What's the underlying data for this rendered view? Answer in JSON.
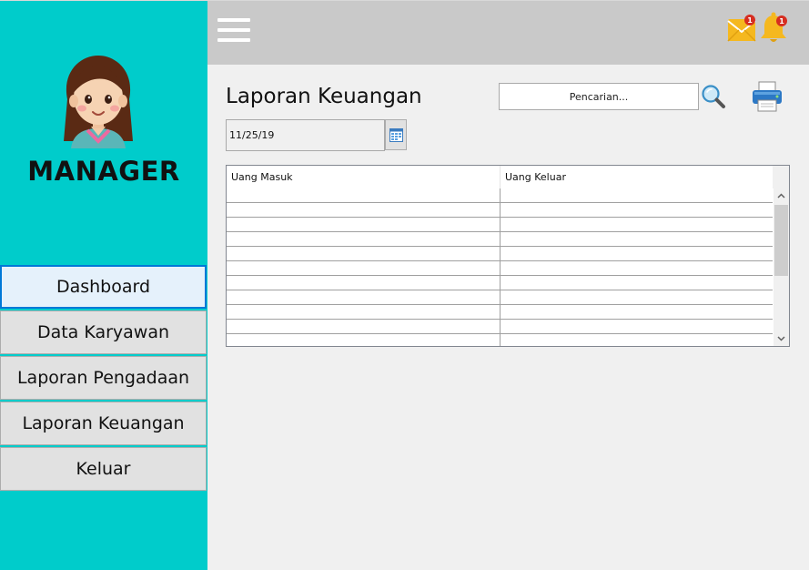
{
  "sidebar": {
    "role": "MANAGER",
    "avatar_icon": "female-user-avatar",
    "accent_color": "#00cccb",
    "menu": [
      {
        "label": "Dashboard",
        "active": true
      },
      {
        "label": "Data Karyawan",
        "active": false
      },
      {
        "label": "Laporan Pengadaan",
        "active": false
      },
      {
        "label": "Laporan Keuangan",
        "active": false
      },
      {
        "label": "Keluar",
        "active": false
      }
    ]
  },
  "topbar": {
    "menu_icon": "hamburger-icon",
    "mail_icon": "mail-icon",
    "mail_badge": "1",
    "bell_icon": "bell-icon",
    "bell_badge": "1"
  },
  "main": {
    "title": "Laporan Keuangan",
    "search_placeholder": "Pencarian...",
    "search_icon": "search-icon",
    "print_icon": "printer-icon",
    "date_value": "11/25/19",
    "calendar_icon": "calendar-icon",
    "table": {
      "columns": [
        "Uang Masuk",
        "Uang Keluar"
      ],
      "rows": [
        [
          "",
          ""
        ],
        [
          "",
          ""
        ],
        [
          "",
          ""
        ],
        [
          "",
          ""
        ],
        [
          "",
          ""
        ],
        [
          "",
          ""
        ],
        [
          "",
          ""
        ],
        [
          "",
          ""
        ],
        [
          "",
          ""
        ],
        [
          "",
          ""
        ],
        [
          "",
          ""
        ]
      ]
    }
  }
}
